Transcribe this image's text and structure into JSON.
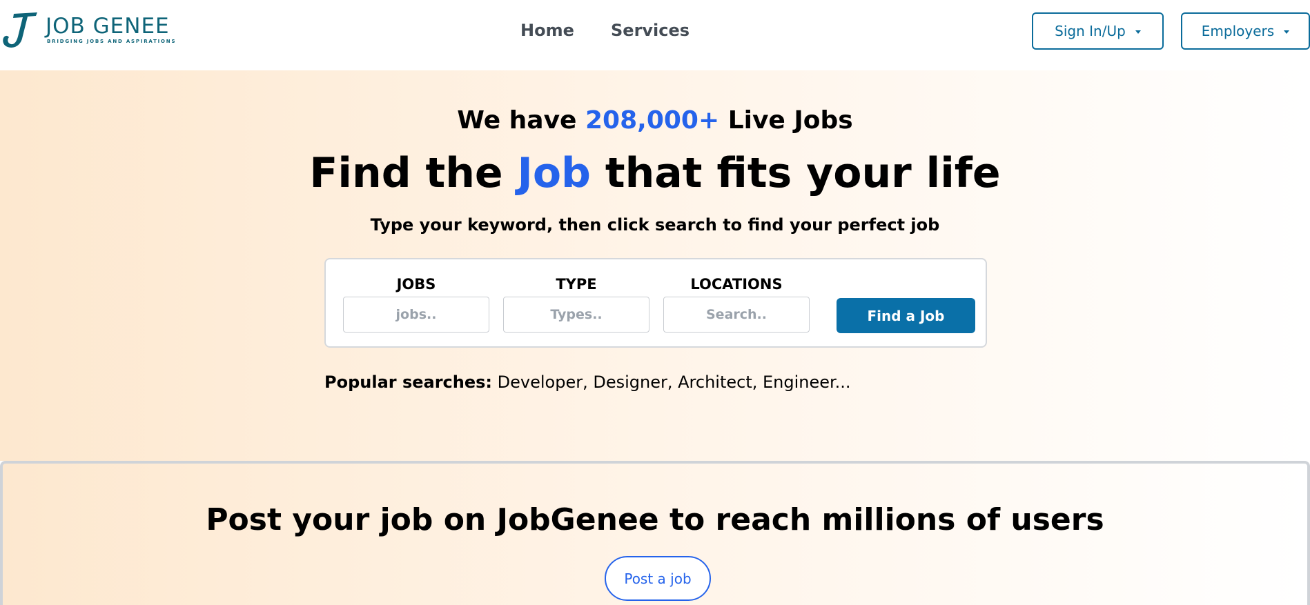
{
  "brand": {
    "name": "JOB GENEE",
    "tagline": "BRIDGING JOBS AND ASPIRATIONS",
    "color": "#0e6478"
  },
  "nav": {
    "home": "Home",
    "services": "Services",
    "signin": "Sign In/Up",
    "employers": "Employers"
  },
  "hero": {
    "live_prefix": "We have",
    "live_count": "208,000+",
    "live_suffix": "Live Jobs",
    "headline_prefix": "Find the",
    "headline_accent": "Job",
    "headline_suffix": "that fits your life",
    "subline": "Type your keyword, then click search to find your perfect job",
    "accent_color": "#2563eb"
  },
  "search": {
    "jobs_label": "JOBS",
    "jobs_placeholder": "jobs..",
    "type_label": "TYPE",
    "type_placeholder": "Types..",
    "locations_label": "LOCATIONS",
    "locations_placeholder": "Search..",
    "submit": "Find a Job"
  },
  "popular": {
    "label": "Popular searches:",
    "items": "Developer, Designer, Architect, Engineer..."
  },
  "post": {
    "title": "Post your job on JobGenee to reach millions of users",
    "button": "Post a job"
  }
}
